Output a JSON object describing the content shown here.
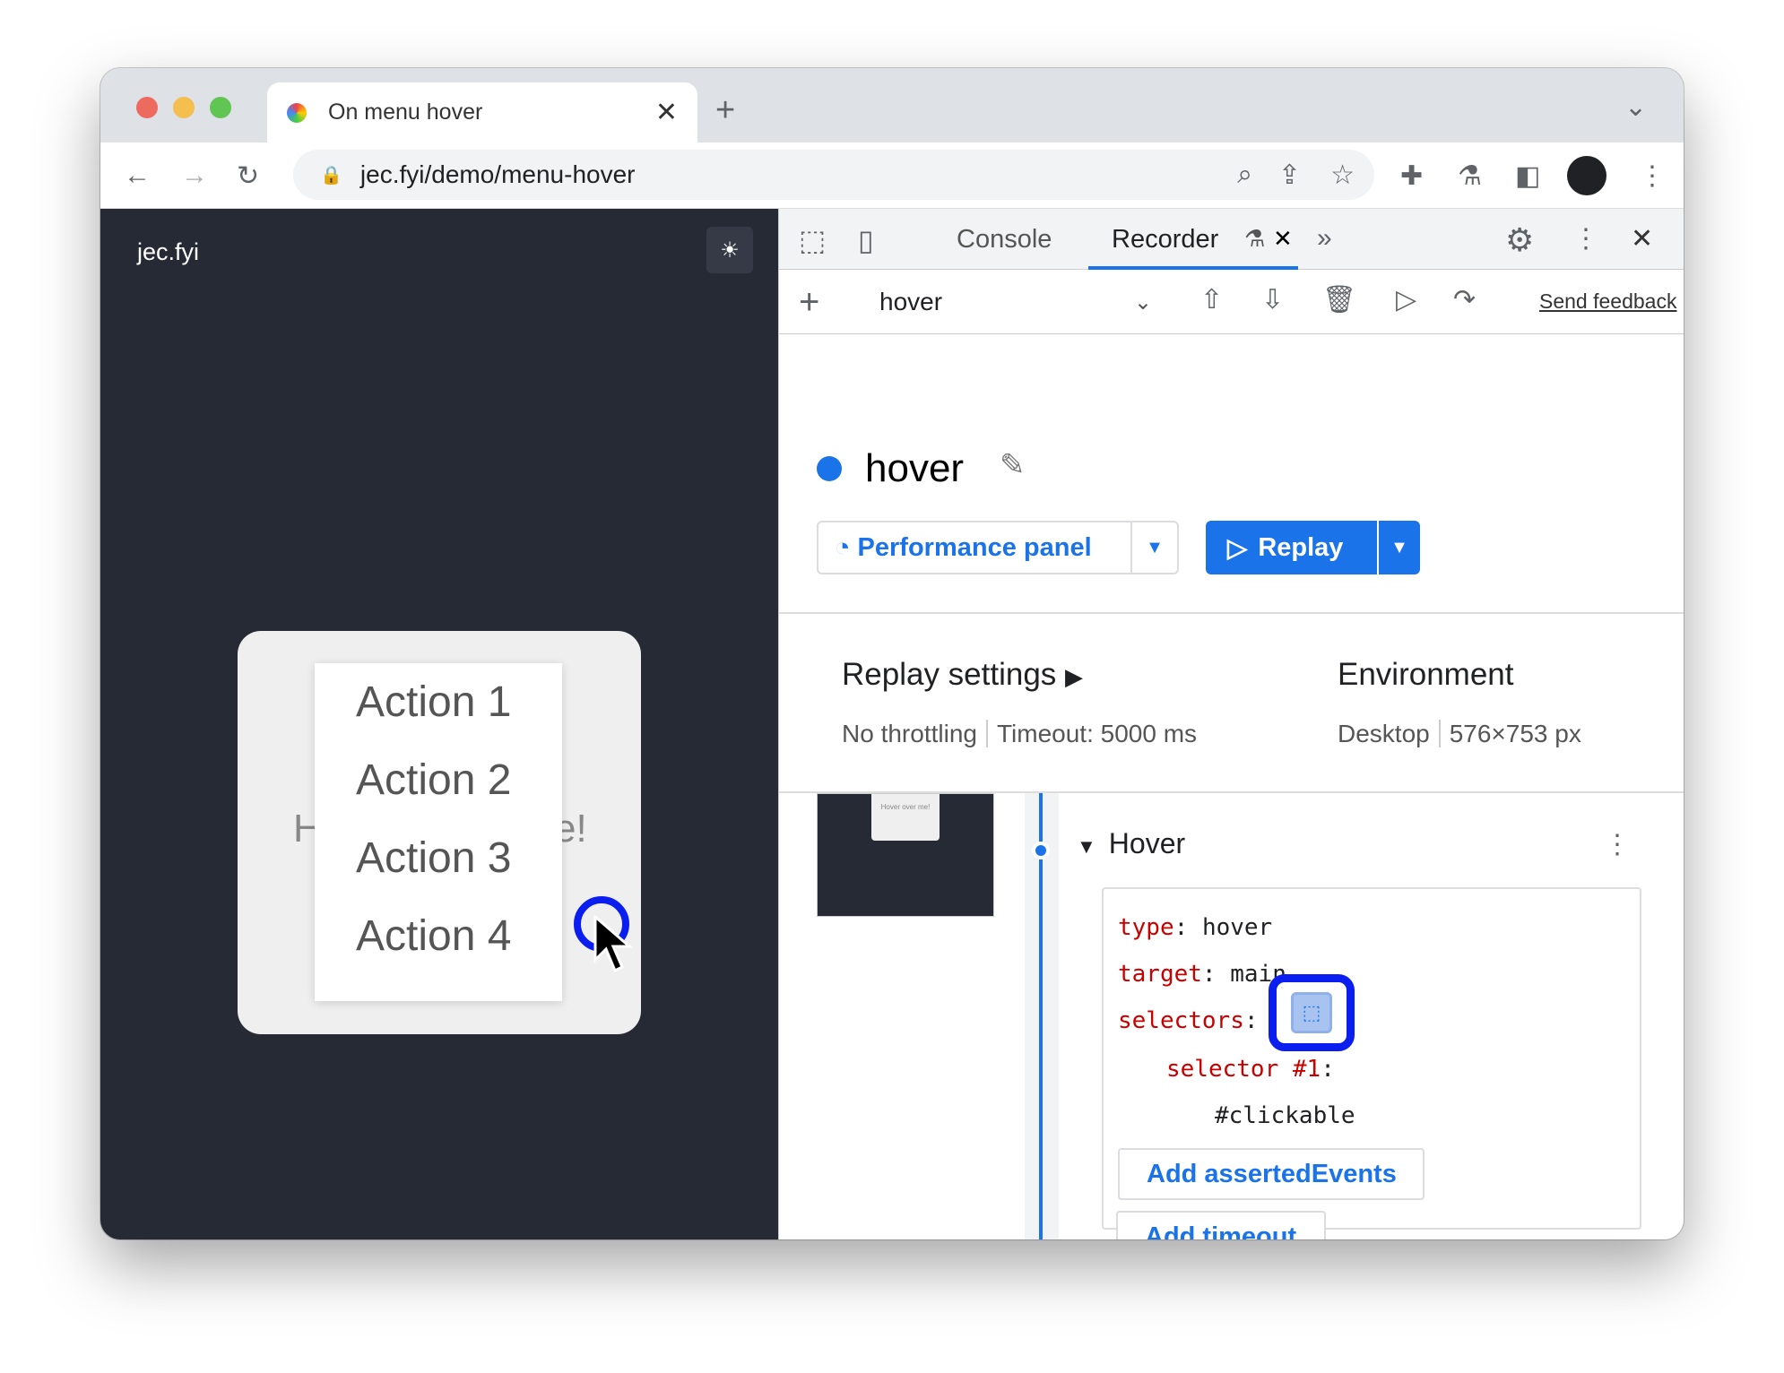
{
  "browser": {
    "tab_title": "On menu hover",
    "url": "jec.fyi/demo/menu-hover"
  },
  "page": {
    "site_name": "jec.fyi",
    "hidden_text_left": "H",
    "hidden_text_right": "e!",
    "menu_items": [
      "Action 1",
      "Action 2",
      "Action 3",
      "Action 4"
    ]
  },
  "devtools": {
    "tabs": [
      "Console",
      "Recorder"
    ],
    "toolbar": {
      "recording_select": "hover",
      "send_feedback": "Send feedback"
    },
    "recording_title": "hover",
    "performance_button": "Performance panel",
    "replay_button": "Replay",
    "replay_settings": {
      "title": "Replay settings",
      "throttling": "No throttling",
      "timeout": "Timeout: 5000 ms"
    },
    "environment": {
      "title": "Environment",
      "device": "Desktop",
      "size": "576×753 px"
    },
    "step": {
      "title": "Hover",
      "thumbnail_text": "Hover over me!",
      "type_key": "type",
      "type_value": "hover",
      "target_key": "target",
      "target_value": "main",
      "selectors_key": "selectors",
      "selector_key": "selector #1",
      "selector_value": "#clickable",
      "add_asserted": "Add assertedEvents",
      "add_timeout": "Add timeout"
    }
  },
  "colors": {
    "accent": "#1a73e8",
    "highlight": "#0a1ef0",
    "key": "#c80000"
  }
}
